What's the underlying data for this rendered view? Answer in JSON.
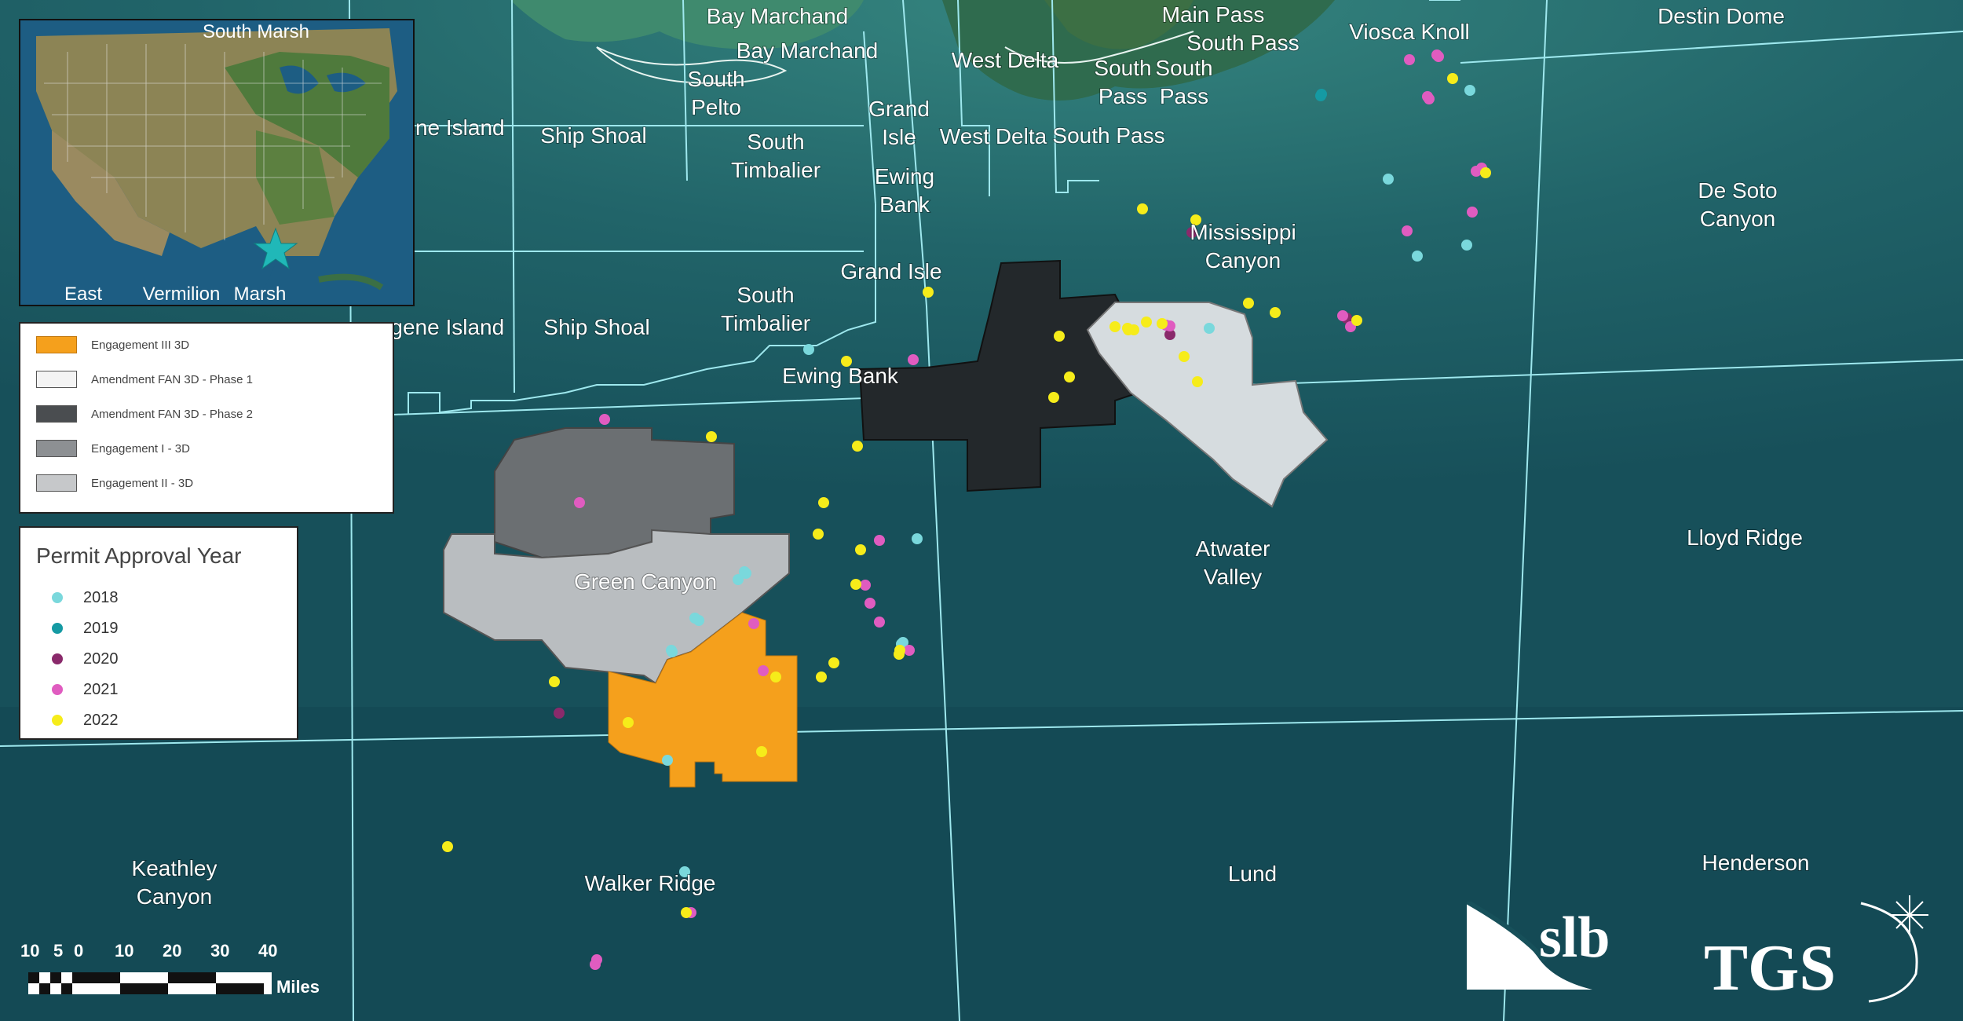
{
  "colors": {
    "ocean": "#17505a",
    "shelf": "#2f7d7d",
    "land": "#2d5a3a",
    "boundary": "#9ee8ee",
    "engagement_iii": "#f5a01c",
    "amendment_phase1": "#d6dcdf",
    "amendment_phase2": "#23282b",
    "engagement_i": "#6b6f72",
    "engagement_ii": "#b9bdc0",
    "year_2018": "#7ad8dc",
    "year_2019": "#159aa3",
    "year_2020": "#8a2a6b",
    "year_2021": "#e05cc0",
    "year_2022": "#f6ec1a"
  },
  "map_labels": [
    {
      "name": "protraction-bay-marchand-1",
      "text": "Bay Marchand"
    },
    {
      "name": "protraction-bay-marchand-2",
      "text": "Bay Marchand"
    },
    {
      "name": "protraction-main-pass",
      "text": "Main Pass"
    },
    {
      "name": "protraction-south-pass-1",
      "text": "South Pass"
    },
    {
      "name": "protraction-viosca-knoll",
      "text": "Viosca Knoll"
    },
    {
      "name": "protraction-destin-dome",
      "text": "Destin Dome"
    },
    {
      "name": "protraction-west-delta-1",
      "text": "West Delta"
    },
    {
      "name": "protraction-west-delta-2",
      "text": "West Delta"
    },
    {
      "name": "protraction-south-pass-2",
      "text": "South Pass"
    },
    {
      "name": "protraction-eugene-island-1",
      "text": "ene Island"
    },
    {
      "name": "protraction-eugene-island-2",
      "text": "ugene Island"
    },
    {
      "name": "protraction-ship-shoal-1",
      "text": "Ship Shoal"
    },
    {
      "name": "protraction-ship-shoal-2",
      "text": "Ship Shoal"
    },
    {
      "name": "protraction-grand-isle-2",
      "text": "Grand Isle"
    },
    {
      "name": "protraction-ewing-bank-2",
      "text": "Ewing Bank"
    },
    {
      "name": "protraction-green-canyon",
      "text": "Green Canyon"
    },
    {
      "name": "protraction-lloyd-ridge",
      "text": "Lloyd Ridge"
    },
    {
      "name": "protraction-lund",
      "text": "Lund"
    },
    {
      "name": "protraction-henderson",
      "text": "Henderson"
    },
    {
      "name": "protraction-walker-ridge",
      "text": "Walker Ridge"
    }
  ],
  "map_labels_multi": [
    {
      "name": "protraction-south-pelto",
      "lines": [
        "South",
        "Pelto"
      ]
    },
    {
      "name": "protraction-south-timbalier-1",
      "lines": [
        "South",
        "Timbalier"
      ]
    },
    {
      "name": "protraction-south-timbalier-2",
      "lines": [
        "South",
        "Timbalier"
      ]
    },
    {
      "name": "protraction-grand-isle-1",
      "lines": [
        "Grand",
        "Isle"
      ]
    },
    {
      "name": "protraction-ewing-bank-1",
      "lines": [
        "Ewing",
        "Bank"
      ]
    },
    {
      "name": "protraction-south-pass-3",
      "lines": [
        "South",
        "Pass"
      ]
    },
    {
      "name": "protraction-south-pass-4",
      "lines": [
        "South",
        "Pass"
      ]
    },
    {
      "name": "protraction-mississippi-canyon",
      "lines": [
        "Mississippi",
        "Canyon"
      ]
    },
    {
      "name": "protraction-de-soto-canyon",
      "lines": [
        "De Soto",
        "Canyon"
      ]
    },
    {
      "name": "protraction-atwater-valley",
      "lines": [
        "Atwater",
        "Valley"
      ]
    },
    {
      "name": "protraction-keathley-canyon",
      "lines": [
        "Keathley",
        "Canyon"
      ]
    }
  ],
  "survey_legend": {
    "items": [
      {
        "label": "Engagement III 3D",
        "color_key": "engagement_iii"
      },
      {
        "label": "Amendment FAN 3D - Phase 1",
        "color_key": "amendment_phase1"
      },
      {
        "label": "Amendment FAN 3D - Phase 2",
        "color_key": "amendment_phase2"
      },
      {
        "label": "Engagement I - 3D",
        "color_key": "engagement_i"
      },
      {
        "label": "Engagement II - 3D",
        "color_key": "engagement_ii"
      }
    ]
  },
  "year_legend": {
    "title": "Permit Approval Year",
    "items": [
      {
        "label": "2018",
        "color_key": "year_2018"
      },
      {
        "label": "2019",
        "color_key": "year_2019"
      },
      {
        "label": "2020",
        "color_key": "year_2020"
      },
      {
        "label": "2021",
        "color_key": "year_2021"
      },
      {
        "label": "2022",
        "color_key": "year_2022"
      }
    ]
  },
  "permits": {
    "2018": 18,
    "2019": 2,
    "2020": 4,
    "2021": 26,
    "2022": 36
  },
  "scale_bar": {
    "ticks": [
      "10",
      "5",
      "0",
      "10",
      "20",
      "30",
      "40"
    ],
    "unit": "Miles"
  },
  "inset": {
    "clipped_labels": [
      "South Marsh",
      "East",
      "Vermilion",
      "Marsh"
    ]
  },
  "logos": {
    "slb": "slb",
    "tgs": "TGS"
  }
}
